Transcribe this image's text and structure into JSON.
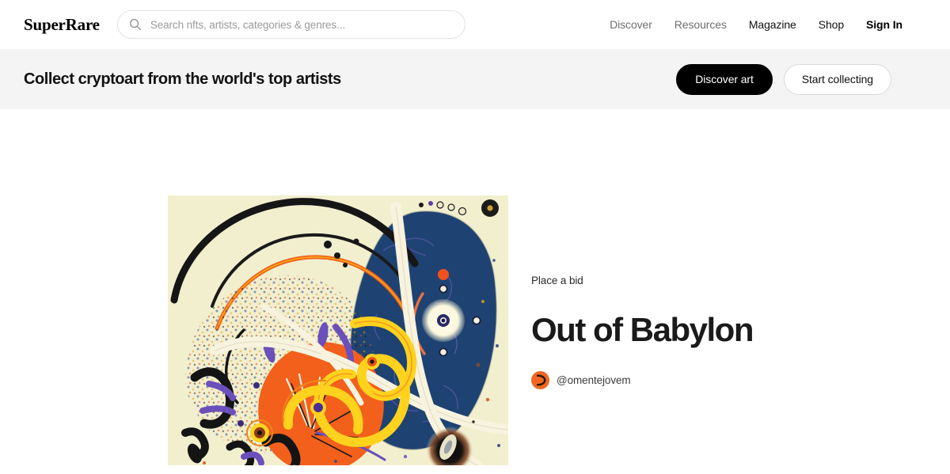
{
  "header": {
    "logo": "SuperRare",
    "search": {
      "placeholder": "Search nfts, artists, categories & genres...",
      "value": "",
      "icon": "search-icon"
    },
    "nav": [
      {
        "label": "Discover",
        "style": "muted"
      },
      {
        "label": "Resources",
        "style": "muted"
      },
      {
        "label": "Magazine",
        "style": "dark"
      },
      {
        "label": "Shop",
        "style": "dark"
      },
      {
        "label": "Sign In",
        "style": "strong"
      }
    ]
  },
  "banner": {
    "title": "Collect cryptoart from the world's top artists",
    "primary_button": "Discover art",
    "secondary_button": "Start collecting",
    "background_color": "#f4f4f5"
  },
  "artwork": {
    "action_label": "Place a bid",
    "title": "Out of Babylon",
    "artist_handle": "@omentejovem",
    "avatar_icon": "artist-avatar-crescent",
    "avatar_color": "#f26722",
    "palette": {
      "canvas": "#f2efcf",
      "navy": "#1e4372",
      "orange": "#f26a28",
      "yellow": "#ffd21e",
      "purple": "#6b4fbb",
      "black": "#131313",
      "cream": "#f5f0da"
    }
  }
}
